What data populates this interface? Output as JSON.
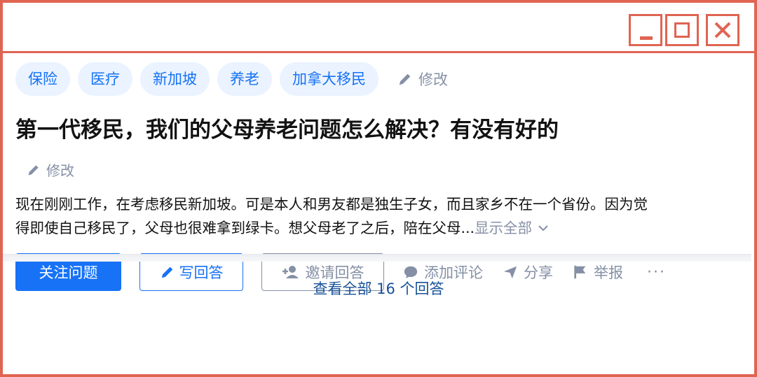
{
  "window": {
    "controls": [
      "minimize-icon",
      "maximize-icon",
      "close-icon"
    ],
    "accent_color": "#e06452"
  },
  "tags": [
    "保险",
    "医疗",
    "新加坡",
    "养老",
    "加拿大移民"
  ],
  "tag_edit_label": "修改",
  "question": {
    "title": "第一代移民，我们的父母养老问题怎么解决？有没有好的",
    "edit_label": "修改",
    "description_line1": "现在刚刚工作，在考虑移民新加坡。可是本人和男友都是独生子女，而且家乡不在一个省份。因为觉",
    "description_line2": "得即使自己移民了，父母也很难拿到绿卡。想父母老了之后，陪在父母...",
    "show_all_label": "显示全部"
  },
  "actions": {
    "follow": "关注问题",
    "write_answer": "写回答",
    "invite": "邀请回答",
    "comment": "添加评论",
    "share": "分享",
    "report": "举报",
    "more": "···"
  },
  "footer": {
    "view_all": "查看全部 16 个回答"
  },
  "colors": {
    "brand": "#1772f6",
    "tag_bg": "#eaf3ff",
    "muted": "#8590a6",
    "link": "#175199"
  }
}
